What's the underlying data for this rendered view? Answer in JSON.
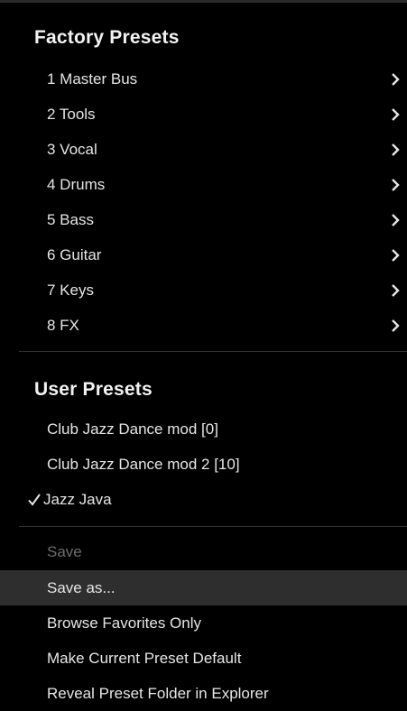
{
  "factory": {
    "heading": "Factory Presets",
    "items": [
      {
        "label": "1 Master Bus"
      },
      {
        "label": "2 Tools"
      },
      {
        "label": "3 Vocal"
      },
      {
        "label": "4 Drums"
      },
      {
        "label": "5 Bass"
      },
      {
        "label": "6 Guitar"
      },
      {
        "label": "7 Keys"
      },
      {
        "label": "8 FX"
      }
    ]
  },
  "user": {
    "heading": "User Presets",
    "items": [
      {
        "label": "Club Jazz Dance mod [0]",
        "checked": false
      },
      {
        "label": "Club Jazz Dance mod 2 [10]",
        "checked": false
      },
      {
        "label": "Jazz Java",
        "checked": true
      }
    ]
  },
  "actions": {
    "save": "Save",
    "save_as": "Save as...",
    "browse_favorites": "Browse Favorites Only",
    "make_default": "Make Current Preset Default",
    "reveal_folder": "Reveal Preset Folder in Explorer"
  },
  "colors": {
    "background": "#000000",
    "text": "#e6e6e6",
    "disabled_text": "#6c6c6c",
    "highlight": "#2e2e2e",
    "divider": "#333333"
  },
  "icons": {
    "submenu": "chevron-right-icon",
    "checked": "checkmark-icon"
  }
}
